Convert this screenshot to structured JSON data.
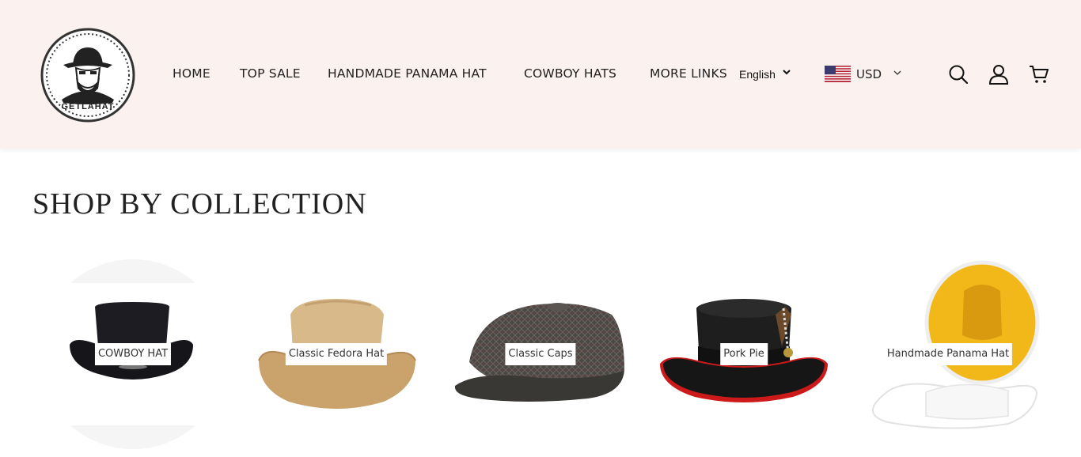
{
  "header": {
    "logo_text": "GETLAHAT",
    "nav": [
      "HOME",
      "TOP SALE",
      "HANDMADE PANAMA HAT",
      "COWBOY HATS",
      "MORE LINKS"
    ],
    "language": "English",
    "currency": "USD",
    "icons": [
      "search-icon",
      "account-icon",
      "cart-icon"
    ]
  },
  "section": {
    "title": "SHOP BY COLLECTION",
    "collections": [
      {
        "label": "COWBOY HAT",
        "icon": "cowboy-hat-image"
      },
      {
        "label": "Classic Fedora Hat",
        "icon": "fedora-hat-image"
      },
      {
        "label": "Classic Caps",
        "icon": "flat-cap-image"
      },
      {
        "label": "Pork Pie",
        "icon": "pork-pie-hat-image"
      },
      {
        "label": "Handmade Panama Hat",
        "icon": "panama-hat-image"
      }
    ]
  },
  "colors": {
    "header_bg": "#fbf1ee",
    "text": "#222222"
  }
}
